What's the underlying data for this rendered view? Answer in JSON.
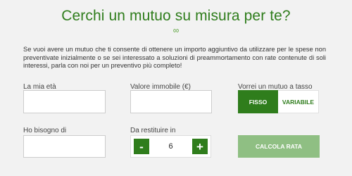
{
  "header": {
    "title": "Cerchi un mutuo su misura per te?",
    "symbol": "∞"
  },
  "intro_text": "Se vuoi avere un mutuo che ti consente di ottenere un importo aggiuntivo da utilizzare per le spese non preventivate inizialmente o se sei interessato a soluzioni di preammortamento con rate contenute di soli interessi, parla con noi per un preventivo più completo!",
  "form": {
    "age": {
      "label": "La mia età",
      "value": "",
      "placeholder": ""
    },
    "property_value": {
      "label": "Valore immobile (€)",
      "value": "",
      "placeholder": ""
    },
    "rate_type": {
      "label": "Vorrei un mutuo a tasso",
      "options": [
        "FISSO",
        "VARIABILE"
      ],
      "selected": "FISSO"
    },
    "amount_needed": {
      "label": "Ho bisogno di",
      "value": "",
      "placeholder": ""
    },
    "repayment": {
      "label": "Da restituire in",
      "value": "6",
      "minus": "-",
      "plus": "+"
    },
    "calculate_button": "CALCOLA RATA"
  },
  "colors": {
    "accent": "#2f7d1c",
    "accent_light": "#8fbf83",
    "background": "#f2f2f2"
  }
}
